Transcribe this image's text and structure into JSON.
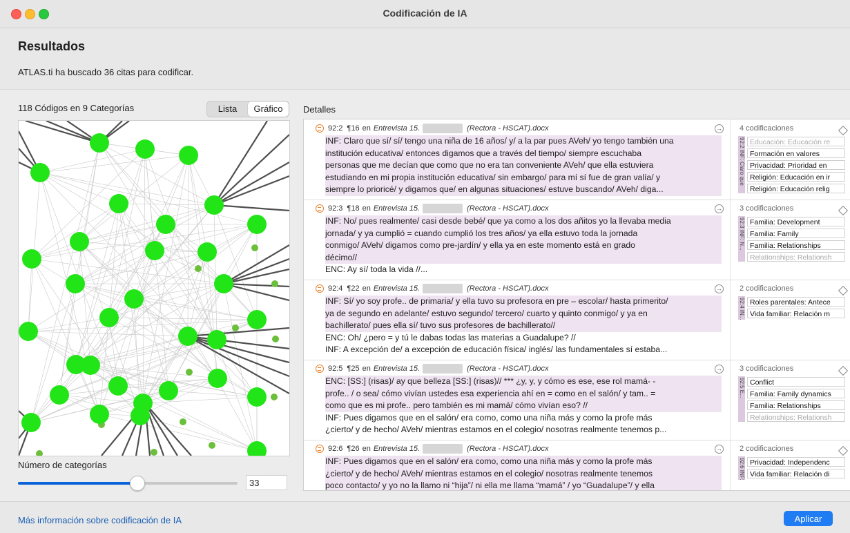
{
  "window": {
    "title": "Codificación de IA"
  },
  "header": {
    "title": "Resultados",
    "subtitle": "ATLAS.ti ha buscado 36 citas para codificar."
  },
  "left": {
    "title": "118 Códigos en 9 Categorías",
    "toggle": {
      "list": "Lista",
      "graph": "Gráfico",
      "selected": "graph"
    },
    "graph": {
      "node_color": "#22e517",
      "edge_color": "#4f4f4f"
    },
    "categories_label": "Número de categorías",
    "slider_value": "33",
    "slider_fraction": 0.54
  },
  "details": {
    "title": "Detalles",
    "rows": [
      {
        "id": "92:2",
        "paragraph": "¶16",
        "en": "en",
        "doc": "Entrevista 15.",
        "doc2": "(Rectora - HSCAT).docx",
        "lines": [
          "INF: Claro que sí/ sí/ tengo una niña de 16 años/ y/ a la par pues AVeh/ yo tengo también una",
          "institución educativa/ entonces digamos que a través del tiempo/ siempre escuchaba",
          "personas que me decían que como que no era tan conveniente AVeh/ que ella estuviera",
          "estudiando en mi propia institución educativa/ sin embargo/ para mí sí fue de gran valía/ y",
          "siempre lo prioricé/ y digamos que/ en algunas situaciones/ estuve buscando/ AVeh/ diga..."
        ],
        "hl_lines": 5,
        "codes_count": "4 codificaciones",
        "vbar": "92:2 INF: Claro que",
        "codes": [
          {
            "label": "Educación: Educación re",
            "dim": true
          },
          {
            "label": "Formación en valores",
            "dim": false
          },
          {
            "label": "Privacidad: Prioridad en",
            "dim": false
          },
          {
            "label": "Religión: Educación en ir",
            "dim": false
          },
          {
            "label": "Religión: Educación relig",
            "dim": false
          }
        ]
      },
      {
        "id": "92:3",
        "paragraph": "¶18",
        "en": "en",
        "doc": "Entrevista 15.",
        "doc2": "(Rectora - HSCAT).docx",
        "lines": [
          "INF: No/ pues realmente/ casi desde bebé/ que ya como a los dos añitos yo la llevaba media",
          "jornada/ y ya cumplió = cuando cumplió los tres años/ ya ella estuvo toda la jornada",
          "conmigo/ AVeh/ digamos como pre-jardín/ y ella ya en este momento está en grado",
          "décimo//",
          "ENC: Ay sí/ toda la vida //..."
        ],
        "hl_lines": 4,
        "codes_count": "3 codificaciones",
        "vbar": "92:3 INF: N...",
        "codes": [
          {
            "label": "Familia: Development",
            "dim": false
          },
          {
            "label": "Familia: Family",
            "dim": false
          },
          {
            "label": "Familia: Relationships",
            "dim": false
          },
          {
            "label": "Relationships: Relationsh",
            "dim": true
          }
        ]
      },
      {
        "id": "92:4",
        "paragraph": "¶22",
        "en": "en",
        "doc": "Entrevista 15.",
        "doc2": "(Rectora - HSCAT).docx",
        "lines": [
          "INF: Sí/ yo soy profe.. de primaria/ y ella tuvo su profesora en pre – escolar/ hasta primerito/",
          "ya de segundo en adelante/ estuvo segundo/ tercero/ cuarto y quinto conmigo/ y ya en",
          "bachillerato/ pues ella sí/ tuvo sus profesores de bachillerato//",
          "ENC: Oh/ ¿pero = y tú le dabas todas las materias a Guadalupe? //",
          "INF: A excepción de/ a excepción de educación física/ inglés/ las fundamentales sí estaba..."
        ],
        "hl_lines": 3,
        "codes_count": "2 codificaciones",
        "vbar": "92:4 IN...",
        "codes": [
          {
            "label": "Roles parentales: Antece",
            "dim": false
          },
          {
            "label": "Vida familiar: Relación m",
            "dim": false
          }
        ]
      },
      {
        "id": "92:5",
        "paragraph": "¶25",
        "en": "en",
        "doc": "Entrevista 15.",
        "doc2": "(Rectora - HSCAT).docx",
        "lines": [
          "ENC: [SS:] (risas)/ ay que belleza [SS:] (risas)// *** ¿y, y, y cómo es ese, ese rol mamá- -",
          "profe.. / o sea/ cómo vivían ustedes esa experiencia ahí en = como en el salón/ y tam.. =",
          "como que es mi profe.. pero también es mi mamá/ cómo vivían eso? //",
          "INF: Pues digamos que en el salón/ era como, como una niña más y como la profe más",
          "¿cierto/ y de hecho/ AVeh/ mientras estamos en el colegio/ nosotras realmente tenemos p..."
        ],
        "hl_lines": 3,
        "codes_count": "3 codificaciones",
        "vbar": "92:5 E...",
        "codes": [
          {
            "label": "Conflict",
            "dim": false
          },
          {
            "label": "Familia: Family dynamics",
            "dim": false
          },
          {
            "label": "Familia: Relationships",
            "dim": false
          },
          {
            "label": "Relationships: Relationsh",
            "dim": true
          }
        ]
      },
      {
        "id": "92:6",
        "paragraph": "¶26",
        "en": "en",
        "doc": "Entrevista 15.",
        "doc2": "(Rectora - HSCAT).docx",
        "lines": [
          "INF: Pues digamos que en el salón/ era como, como una niña más y como la profe más",
          "¿cierto/ y de hecho/ AVeh/ mientras estamos en el colegio/ nosotras realmente tenemos",
          "poco contacto/ y yo no la llamo ni “hija”/ ni ella me llama “mamá” / yo “Guadalupe”/ y ella"
        ],
        "hl_lines": 3,
        "codes_count": "2 codificaciones",
        "vbar": "92:6 INF:",
        "codes": [
          {
            "label": "Privacidad: Independenc",
            "dim": false
          },
          {
            "label": "Vida familiar: Relación di",
            "dim": false
          }
        ]
      }
    ]
  },
  "footer": {
    "link": "Más información sobre codificación de IA",
    "apply": "Aplicar"
  }
}
